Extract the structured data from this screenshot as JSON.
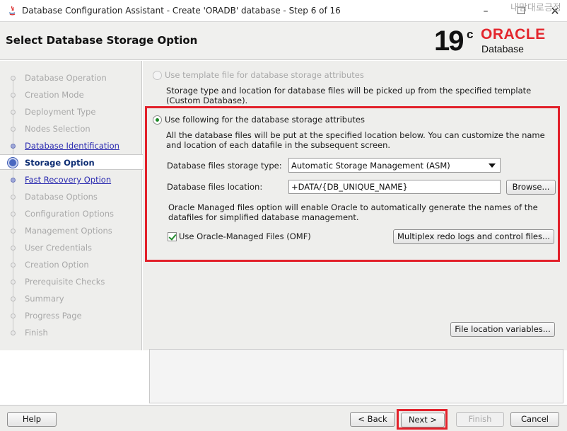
{
  "window": {
    "title": "Database Configuration Assistant - Create 'ORADB' database - Step 6 of 16",
    "overlay_text": "내맘대로긍정",
    "minimize": "–",
    "maximize": "☐",
    "close": "✕"
  },
  "header": {
    "page_title": "Select Database Storage Option",
    "logo_version": "19",
    "logo_superscript": "c",
    "logo_brand": "ORACLE",
    "logo_product": "Database"
  },
  "nav": {
    "items": [
      {
        "label": "Database Operation",
        "state": "disabled"
      },
      {
        "label": "Creation Mode",
        "state": "disabled"
      },
      {
        "label": "Deployment Type",
        "state": "disabled"
      },
      {
        "label": "Nodes Selection",
        "state": "disabled"
      },
      {
        "label": "Database Identification",
        "state": "done"
      },
      {
        "label": "Storage Option",
        "state": "active"
      },
      {
        "label": "Fast Recovery Option",
        "state": "done"
      },
      {
        "label": "Database Options",
        "state": "disabled"
      },
      {
        "label": "Configuration Options",
        "state": "disabled"
      },
      {
        "label": "Management Options",
        "state": "disabled"
      },
      {
        "label": "User Credentials",
        "state": "disabled"
      },
      {
        "label": "Creation Option",
        "state": "disabled"
      },
      {
        "label": "Prerequisite Checks",
        "state": "disabled"
      },
      {
        "label": "Summary",
        "state": "disabled"
      },
      {
        "label": "Progress Page",
        "state": "disabled"
      },
      {
        "label": "Finish",
        "state": "disabled"
      }
    ]
  },
  "content": {
    "template_option_label": "Use template file for database storage attributes",
    "template_desc_1": "Storage type and location for database files will be picked up from the specified template",
    "template_desc_2": "(Custom Database).",
    "following_option_label": "Use following for the database storage attributes",
    "following_desc_1": "All the database files will be put at the specified location below. You can customize the name",
    "following_desc_2": "and location of each datafile in the subsequent screen.",
    "storage_type_label": "Database files storage type:",
    "storage_type_value": "Automatic Storage Management (ASM)",
    "location_label": "Database files location:",
    "location_value": "+DATA/{DB_UNIQUE_NAME}",
    "browse_button": "Browse...",
    "omf_desc_1": "Oracle Managed files option will enable Oracle to automatically generate the names of the",
    "omf_desc_2": "datafiles for simplified database management.",
    "omf_checkbox_label": "Use Oracle-Managed Files (OMF)",
    "omf_checked": true,
    "multiplex_button": "Multiplex redo logs and control files...",
    "file_location_variables_button": "File location variables..."
  },
  "footer": {
    "help": "Help",
    "back": "< Back",
    "next": "Next >",
    "finish": "Finish",
    "cancel": "Cancel"
  },
  "colors": {
    "highlight_red": "#e2202a",
    "oracle_red": "#e3262d",
    "active_nav": "#0d2d73",
    "done_nav": "#2a2ab0"
  }
}
